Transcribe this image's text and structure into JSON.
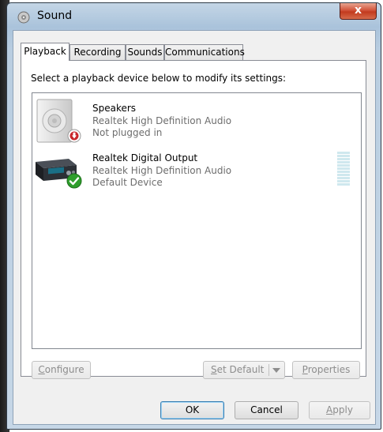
{
  "window": {
    "title": "Sound",
    "close_label": "x"
  },
  "tabs": [
    {
      "label": "Playback",
      "active": true
    },
    {
      "label": "Recording",
      "active": false
    },
    {
      "label": "Sounds",
      "active": false
    },
    {
      "label": "Communications",
      "active": false
    }
  ],
  "instruction": "Select a playback device below to modify its settings:",
  "devices": [
    {
      "name": "Speakers",
      "driver": "Realtek High Definition Audio",
      "status": "Not plugged in",
      "icon": "speaker-icon",
      "badge": "unplugged-badge-icon"
    },
    {
      "name": "Realtek Digital Output",
      "driver": "Realtek High Definition Audio",
      "status": "Default Device",
      "icon": "digital-output-icon",
      "badge": "default-check-icon",
      "level_percent": 0
    }
  ],
  "panel_buttons": {
    "configure": {
      "first": "C",
      "rest": "onfigure"
    },
    "set_default": {
      "first": "S",
      "rest": "et Default"
    },
    "properties": {
      "first": "P",
      "rest": "roperties"
    }
  },
  "dialog_buttons": {
    "ok": "OK",
    "cancel": "Cancel",
    "apply": {
      "first": "A",
      "rest": "pply"
    }
  },
  "colors": {
    "title_gradient_top": "#c4d6e6",
    "close_red": "#c23a1e",
    "check_green": "#2e9e2c",
    "level_meter": "#cfe8ee"
  }
}
